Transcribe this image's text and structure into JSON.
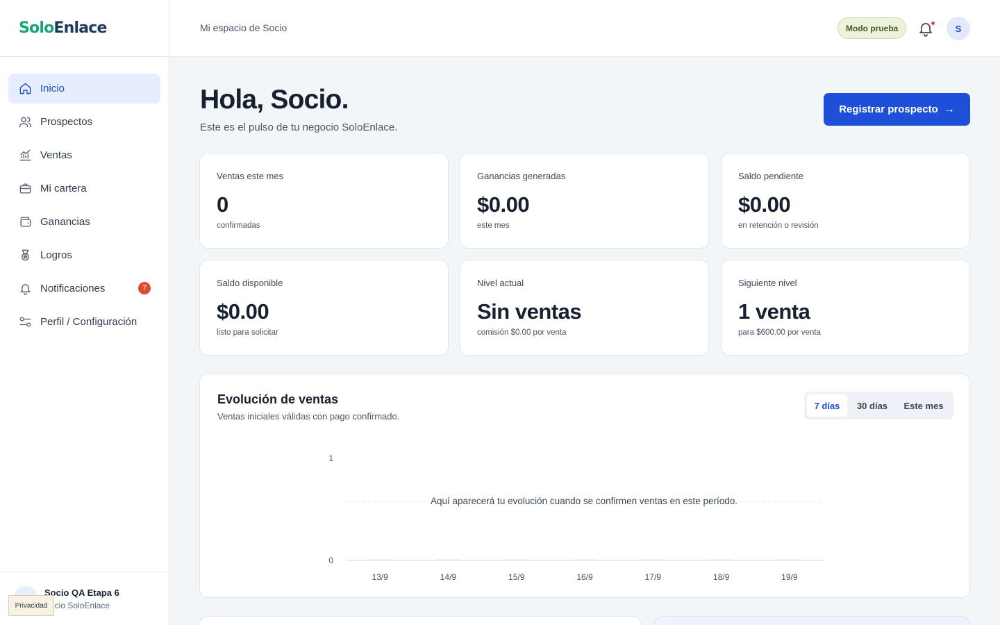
{
  "brand": {
    "part1": "Solo",
    "part2": "Enlace"
  },
  "sidebar": {
    "items": [
      {
        "label": "Inicio",
        "icon": "home-icon",
        "active": true
      },
      {
        "label": "Prospectos",
        "icon": "users-icon"
      },
      {
        "label": "Ventas",
        "icon": "chart-icon"
      },
      {
        "label": "Mi cartera",
        "icon": "briefcase-icon"
      },
      {
        "label": "Ganancias",
        "icon": "wallet-icon"
      },
      {
        "label": "Logros",
        "icon": "medal-icon"
      },
      {
        "label": "Notificaciones",
        "icon": "bell-icon",
        "badge": "7"
      },
      {
        "label": "Perfil / Configuración",
        "icon": "sliders-icon"
      }
    ],
    "user": {
      "name": "Socio QA Etapa 6",
      "role": "Socio SoloEnlace"
    },
    "privacy_label": "Privacidad"
  },
  "topbar": {
    "space_label": "Mi espacio de Socio",
    "mode_label": "Modo prueba",
    "avatar_initial": "S"
  },
  "main": {
    "greeting": "Hola, Socio.",
    "subtitle": "Este es el pulso de tu negocio SoloEnlace.",
    "cta_label": "Registrar prospecto",
    "cards": [
      {
        "label": "Ventas este mes",
        "value": "0",
        "sub": "confirmadas"
      },
      {
        "label": "Ganancias generadas",
        "value": "$0.00",
        "sub": "este mes"
      },
      {
        "label": "Saldo pendiente",
        "value": "$0.00",
        "sub": "en retención o revisión"
      },
      {
        "label": "Saldo disponible",
        "value": "$0.00",
        "sub": "listo para solicitar"
      },
      {
        "label": "Nivel actual",
        "value": "Sin ventas",
        "sub": "comisión $0.00 por venta"
      },
      {
        "label": "Siguiente nivel",
        "value": "1 venta",
        "sub": "para $600.00 por venta"
      }
    ],
    "chart": {
      "title": "Evolución de ventas",
      "subtitle": "Ventas iniciales válidas con pago confirmado.",
      "tabs": [
        {
          "label": "7 días",
          "active": true
        },
        {
          "label": "30 días"
        },
        {
          "label": "Este mes"
        }
      ],
      "empty_message": "Aquí aparecerá tu evolución cuando se confirmen ventas en este período."
    }
  },
  "colors": {
    "accent": "#1d50d6",
    "brand_green": "#1aa37a",
    "badge_red": "#dc4a3b"
  },
  "chart_data": {
    "type": "bar",
    "categories": [
      "13/9",
      "14/9",
      "15/9",
      "16/9",
      "17/9",
      "18/9",
      "19/9"
    ],
    "values": [
      0,
      0,
      0,
      0,
      0,
      0,
      0
    ],
    "ylim": [
      0,
      1
    ],
    "yticks": [
      "0",
      "1"
    ],
    "grid": true
  }
}
